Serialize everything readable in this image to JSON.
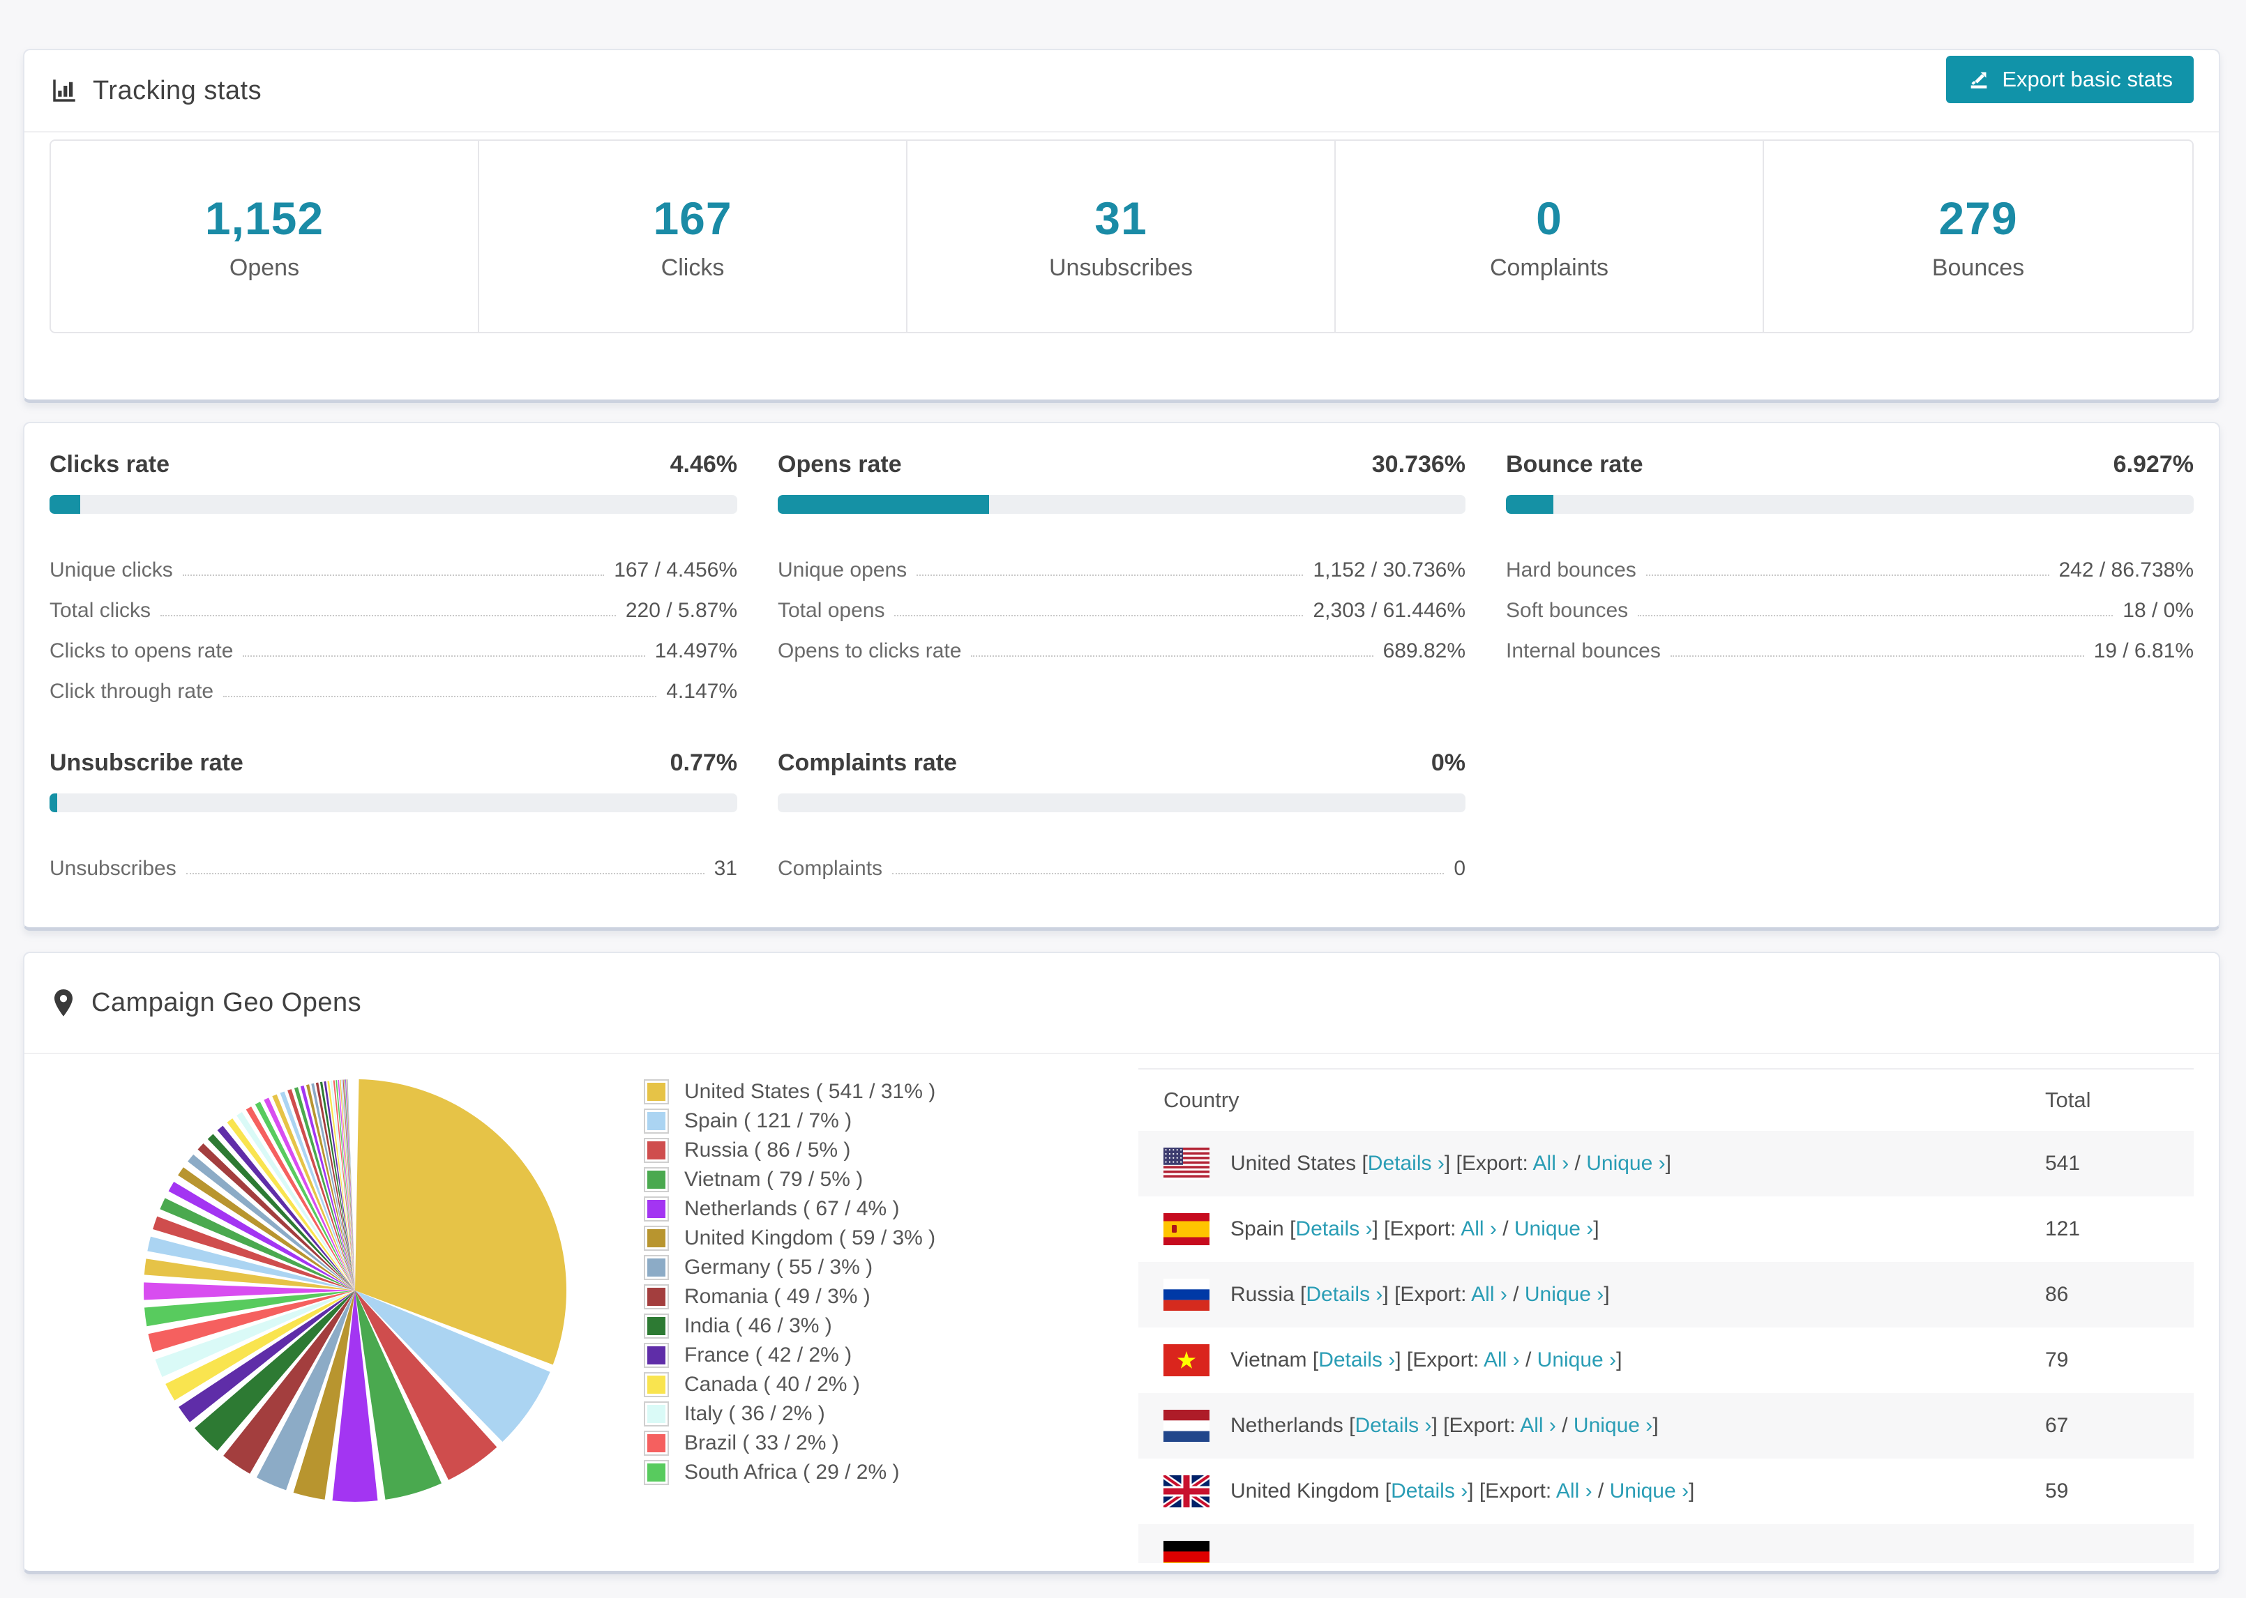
{
  "colors": {
    "accent_teal": "#1591a5",
    "button_teal": "#1193a9",
    "number_teal": "#1a8ba6",
    "link_teal": "#2a9db5"
  },
  "tracking": {
    "title": "Tracking stats",
    "export_button": "Export basic stats",
    "summary": [
      {
        "value": "1,152",
        "label": "Opens"
      },
      {
        "value": "167",
        "label": "Clicks"
      },
      {
        "value": "31",
        "label": "Unsubscribes"
      },
      {
        "value": "0",
        "label": "Complaints"
      },
      {
        "value": "279",
        "label": "Bounces"
      }
    ]
  },
  "rates": [
    {
      "row": 1,
      "title": "Clicks rate",
      "value": "4.46%",
      "percent": 4.46,
      "stats": [
        [
          "Unique clicks",
          "167 / 4.456%"
        ],
        [
          "Total clicks",
          "220 / 5.87%"
        ],
        [
          "Clicks to opens rate",
          "14.497%"
        ],
        [
          "Click through rate",
          "4.147%"
        ]
      ]
    },
    {
      "row": 1,
      "title": "Opens rate",
      "value": "30.736%",
      "percent": 30.736,
      "stats": [
        [
          "Unique opens",
          "1,152 / 30.736%"
        ],
        [
          "Total opens",
          "2,303 / 61.446%"
        ],
        [
          "Opens to clicks rate",
          "689.82%"
        ]
      ]
    },
    {
      "row": 1,
      "title": "Bounce rate",
      "value": "6.927%",
      "percent": 6.927,
      "stats": [
        [
          "Hard bounces",
          "242 / 86.738%"
        ],
        [
          "Soft bounces",
          "18 / 0%"
        ],
        [
          "Internal bounces",
          "19 / 6.81%"
        ]
      ]
    },
    {
      "row": 2,
      "title": "Unsubscribe rate",
      "value": "0.77%",
      "percent": 0.77,
      "stats": [
        [
          "Unsubscribes",
          "31"
        ]
      ]
    },
    {
      "row": 2,
      "title": "Complaints rate",
      "value": "0%",
      "percent": 0,
      "stats": [
        [
          "Complaints",
          "0"
        ]
      ]
    }
  ],
  "geo": {
    "title": "Campaign Geo Opens",
    "table": {
      "columns": [
        "Country",
        "Total"
      ],
      "links": {
        "open": "[",
        "close": "]",
        "details": "Details",
        "export_label": "Export:",
        "all": "All",
        "unique": "Unique",
        "slash": "/",
        "arrow": "›"
      },
      "rows": [
        {
          "flag": "us",
          "country": "United States",
          "total": "541"
        },
        {
          "flag": "es",
          "country": "Spain",
          "total": "121"
        },
        {
          "flag": "ru",
          "country": "Russia",
          "total": "86"
        },
        {
          "flag": "vn",
          "country": "Vietnam",
          "total": "79"
        },
        {
          "flag": "nl",
          "country": "Netherlands",
          "total": "67"
        },
        {
          "flag": "gb",
          "country": "United Kingdom",
          "total": "59"
        }
      ],
      "partial_row": {
        "flag": "de"
      }
    }
  },
  "chart_data": {
    "type": "pie",
    "title": "Campaign Geo Opens",
    "legend_position": "right",
    "start_angle_deg": 0,
    "direction": "clockwise",
    "palette": [
      "#e6c347",
      "#abd4f2",
      "#cf4d4d",
      "#4aa94f",
      "#a335f2",
      "#b8952f",
      "#8cabc6",
      "#a33e3e",
      "#2d7a33",
      "#5f2da8",
      "#f9e44f",
      "#dafaf7",
      "#f5605f",
      "#58cb5e",
      "#d84df0"
    ],
    "slices": [
      {
        "label": "United States",
        "value": 541,
        "pct": 31,
        "legend": "United States ( 541 / 31% )",
        "color": "#e6c347"
      },
      {
        "label": "Spain",
        "value": 121,
        "pct": 7,
        "legend": "Spain ( 121 / 7% )",
        "color": "#abd4f2"
      },
      {
        "label": "Russia",
        "value": 86,
        "pct": 5,
        "legend": "Russia ( 86 / 5% )",
        "color": "#cf4d4d"
      },
      {
        "label": "Vietnam",
        "value": 79,
        "pct": 5,
        "legend": "Vietnam ( 79 / 5% )",
        "color": "#4aa94f"
      },
      {
        "label": "Netherlands",
        "value": 67,
        "pct": 4,
        "legend": "Netherlands ( 67 / 4% )",
        "color": "#a335f2"
      },
      {
        "label": "United Kingdom",
        "value": 59,
        "pct": 3,
        "legend": "United Kingdom ( 59 / 3% )",
        "color": "#b8952f"
      },
      {
        "label": "Germany",
        "value": 55,
        "pct": 3,
        "legend": "Germany ( 55 / 3% )",
        "color": "#8cabc6"
      },
      {
        "label": "Romania",
        "value": 49,
        "pct": 3,
        "legend": "Romania ( 49 / 3% )",
        "color": "#a33e3e"
      },
      {
        "label": "India",
        "value": 46,
        "pct": 3,
        "legend": "India ( 46 / 3% )",
        "color": "#2d7a33"
      },
      {
        "label": "France",
        "value": 42,
        "pct": 2,
        "legend": "France ( 42 / 2% )",
        "color": "#5f2da8"
      },
      {
        "label": "Canada",
        "value": 40,
        "pct": 2,
        "legend": "Canada ( 40 / 2% )",
        "color": "#f9e44f"
      },
      {
        "label": "Italy",
        "value": 36,
        "pct": 2,
        "legend": "Italy ( 36 / 2% )",
        "color": "#dafaf7"
      },
      {
        "label": "Brazil",
        "value": 33,
        "pct": 2,
        "legend": "Brazil ( 33 / 2% )",
        "color": "#f5605f"
      },
      {
        "label": "South Africa",
        "value": 29,
        "pct": 2,
        "legend": "South Africa ( 29 / 2% )",
        "color": "#58cb5e"
      }
    ],
    "tail_pcts": [
      1.9,
      1.8,
      1.7,
      1.6,
      1.5,
      1.4,
      1.3,
      1.2,
      1.1,
      1.0,
      0.95,
      0.9,
      0.85,
      0.8,
      0.75,
      0.7,
      0.65,
      0.6,
      0.55,
      0.5,
      0.45,
      0.4,
      0.36,
      0.33,
      0.3,
      0.27,
      0.24,
      0.21,
      0.19,
      0.17,
      0.15,
      0.13,
      0.11,
      0.1,
      0.09,
      0.08,
      0.07,
      0.06
    ]
  }
}
